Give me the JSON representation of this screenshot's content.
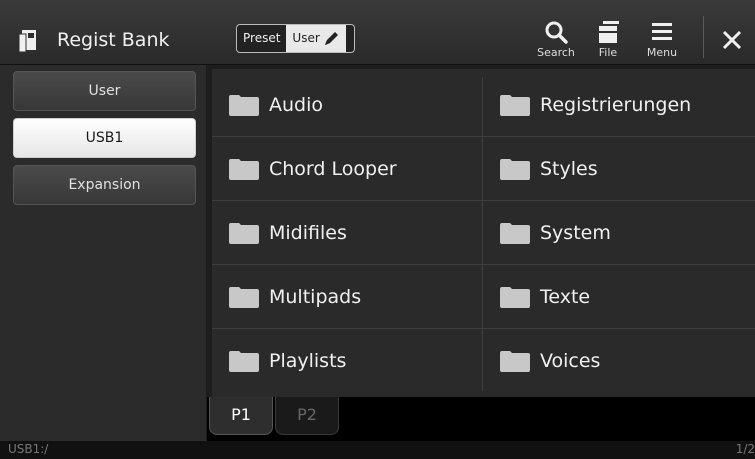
{
  "header": {
    "title": "Regist Bank",
    "toggle": {
      "preset": "Preset",
      "user": "User"
    },
    "search_label": "Search",
    "file_label": "File",
    "menu_label": "Menu"
  },
  "sidebar": {
    "items": [
      {
        "label": "User"
      },
      {
        "label": "USB1"
      },
      {
        "label": "Expansion"
      }
    ],
    "selected": "USB1"
  },
  "folders": [
    "Audio",
    "Registrierungen",
    "Chord Looper",
    "Styles",
    "Midifiles",
    "System",
    "Multipads",
    "Texte",
    "Playlists",
    "Voices"
  ],
  "tabs": [
    {
      "label": "P1",
      "active": true
    },
    {
      "label": "P2",
      "active": false
    }
  ],
  "status": {
    "path": "USB1:/",
    "page": "1/2"
  },
  "colors": {
    "background": "#1c1c1c",
    "folder": "#c8c8c8",
    "selected": "#ffffff"
  }
}
